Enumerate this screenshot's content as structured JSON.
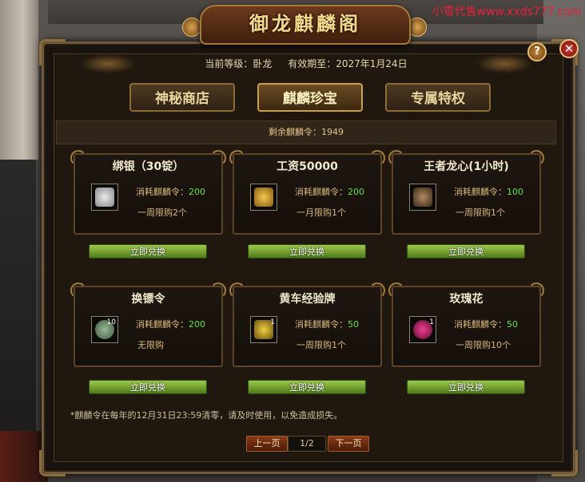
{
  "watermark": "小雪代售www.xxds777.com",
  "title": "御龙麒麟阁",
  "help_label": "?",
  "close_label": "✕",
  "info": {
    "level_text": "当前等级：卧龙",
    "expire_text": "有效期至：2027年1月24日"
  },
  "tabs": [
    {
      "label": "神秘商店",
      "active": false
    },
    {
      "label": "麒麟珍宝",
      "active": true
    },
    {
      "label": "专属特权",
      "active": false
    }
  ],
  "remaining_text": "剩余麒麟令：1949",
  "cost_label": "消耗麒麟令：",
  "items": [
    {
      "name": "绑银（30锭）",
      "cost": "200",
      "limit": "一周限购2个",
      "qty": "",
      "icon": "silver-ingot-icon",
      "icon_color": "#c8c8c8",
      "button": "立即兑换"
    },
    {
      "name": "工资50000",
      "cost": "200",
      "limit": "一月限购1个",
      "qty": "",
      "icon": "money-chest-icon",
      "icon_color": "#c89a30",
      "button": "立即兑换"
    },
    {
      "name": "王者龙心(1小时)",
      "cost": "100",
      "limit": "一周限购1个",
      "qty": "",
      "icon": "dragon-head-icon",
      "icon_color": "#8a6a48",
      "button": "立即兑换"
    },
    {
      "name": "换镖令",
      "cost": "200",
      "limit": "无限购",
      "qty": "10",
      "icon": "jade-token-icon",
      "icon_color": "#6a8a6a",
      "button": "立即兑换"
    },
    {
      "name": "黄车经验牌",
      "cost": "50",
      "limit": "一周限购1个",
      "qty": "1",
      "icon": "gold-cart-icon",
      "icon_color": "#c8a020",
      "button": "立即兑换"
    },
    {
      "name": "玫瑰花",
      "cost": "50",
      "limit": "一周限购10个",
      "qty": "1",
      "icon": "rose-icon",
      "icon_color": "#c0206a",
      "button": "立即兑换"
    }
  ],
  "note": "*麒麟令在每年的12月31日23:59清零，请及时使用，以免造成损失。",
  "pager": {
    "prev_label": "上一页",
    "page_text": "1/2",
    "next_label": "下一页"
  }
}
